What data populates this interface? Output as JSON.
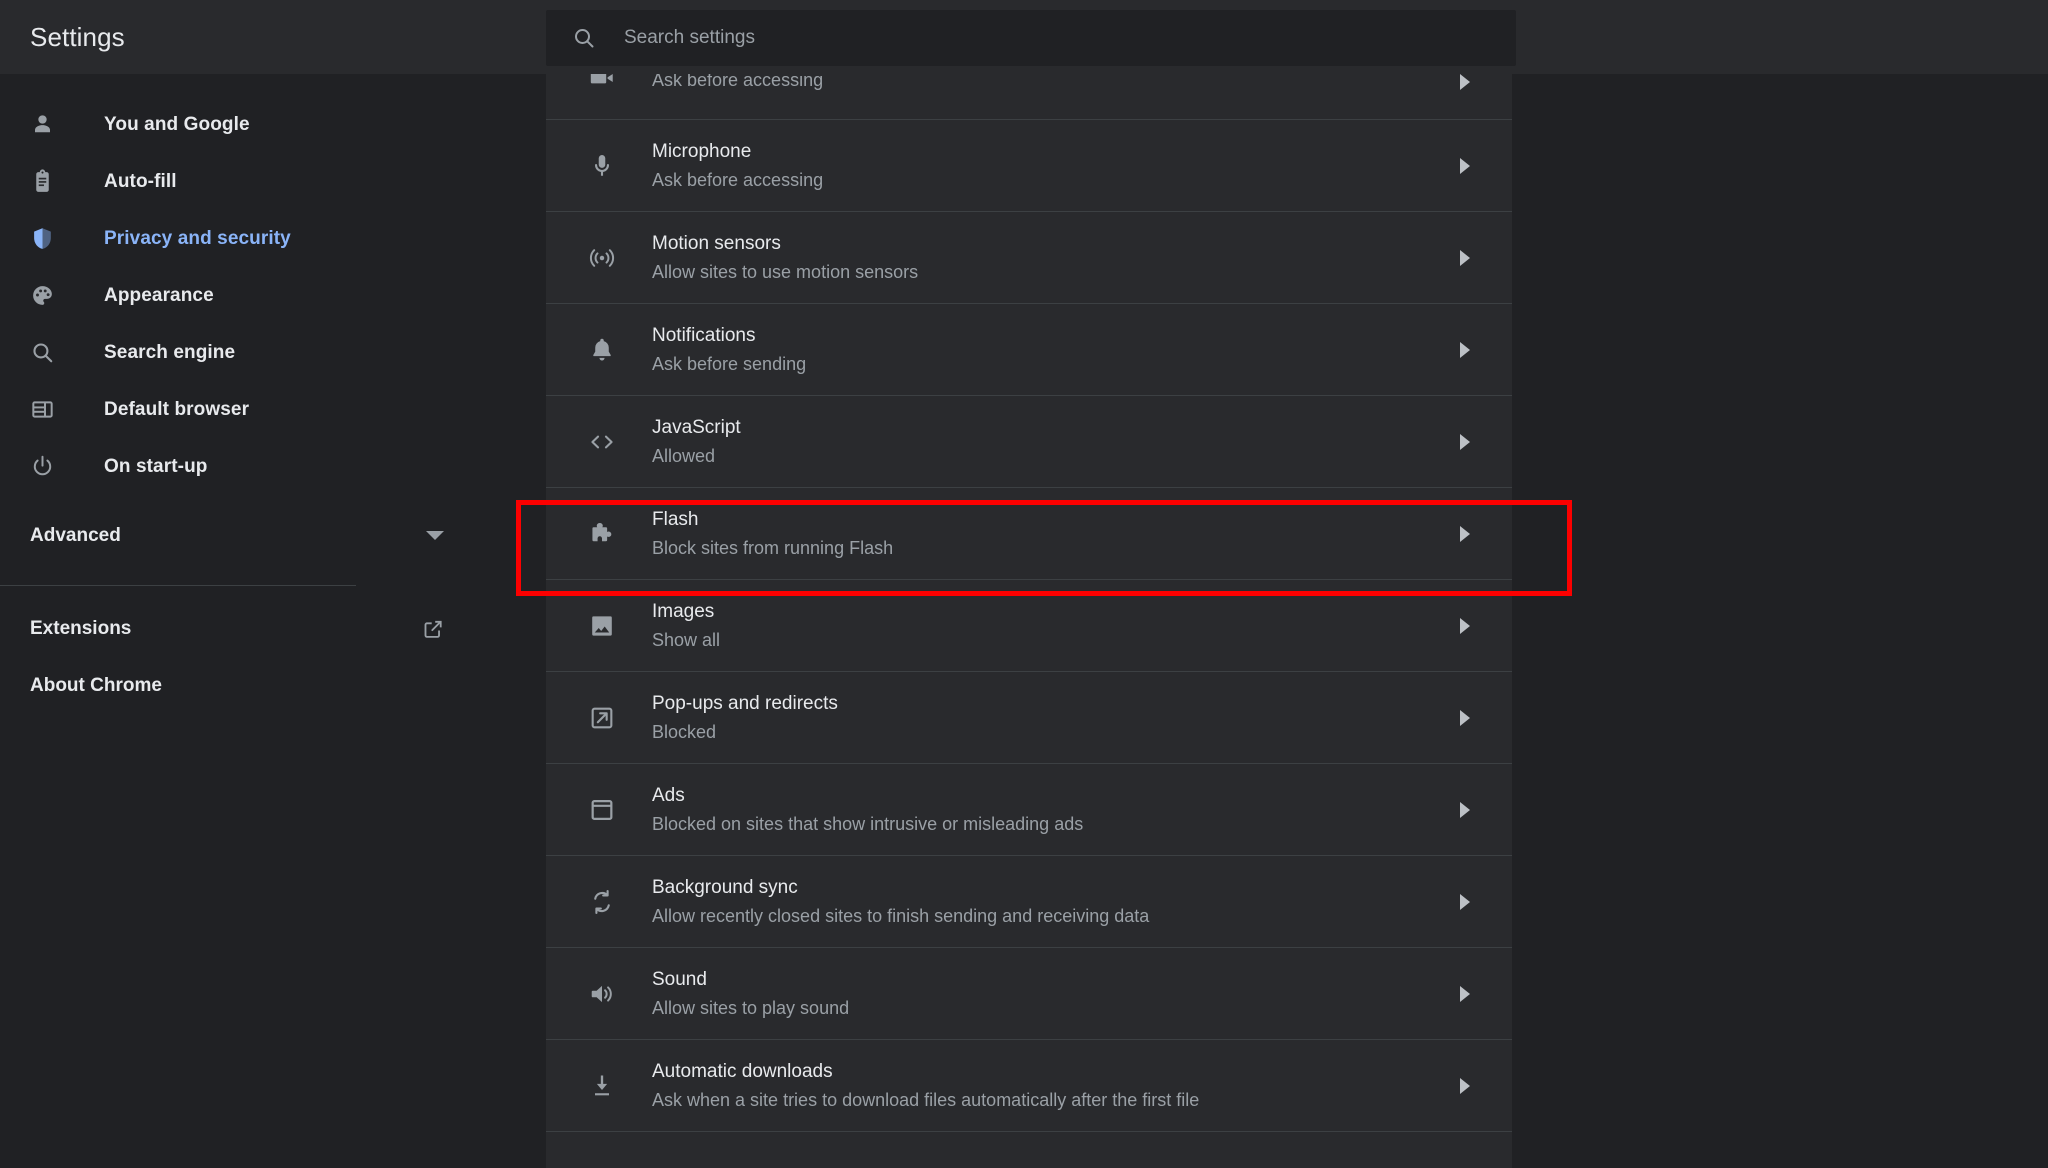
{
  "topbar": {
    "title": "Settings",
    "search": {
      "placeholder": "Search settings",
      "value": "",
      "icon": "search-icon"
    }
  },
  "sidebar": {
    "items": [
      {
        "label": "You and Google",
        "icon": "person-icon",
        "active": false
      },
      {
        "label": "Auto-fill",
        "icon": "clipboard-icon",
        "active": false
      },
      {
        "label": "Privacy and security",
        "icon": "shield-icon",
        "active": true
      },
      {
        "label": "Appearance",
        "icon": "palette-icon",
        "active": false
      },
      {
        "label": "Search engine",
        "icon": "magnifier-icon",
        "active": false
      },
      {
        "label": "Default browser",
        "icon": "browser-window-icon",
        "active": false
      },
      {
        "label": "On start-up",
        "icon": "power-icon",
        "active": false
      }
    ],
    "advanced": {
      "label": "Advanced",
      "icon": "chevron-down-icon"
    },
    "footer": [
      {
        "label": "Extensions",
        "icon": "external-link-icon"
      },
      {
        "label": "About Chrome",
        "icon": ""
      }
    ]
  },
  "content": {
    "rows": [
      {
        "title": "",
        "sub": "Ask before accessing",
        "icon": "camera-icon",
        "partial": true,
        "highlighted": false
      },
      {
        "title": "Microphone",
        "sub": "Ask before accessing",
        "icon": "microphone-icon",
        "partial": false,
        "highlighted": false
      },
      {
        "title": "Motion sensors",
        "sub": "Allow sites to use motion sensors",
        "icon": "motion-sensor-icon",
        "partial": false,
        "highlighted": false
      },
      {
        "title": "Notifications",
        "sub": "Ask before sending",
        "icon": "bell-icon",
        "partial": false,
        "highlighted": false
      },
      {
        "title": "JavaScript",
        "sub": "Allowed",
        "icon": "code-brackets-icon",
        "partial": false,
        "highlighted": false
      },
      {
        "title": "Flash",
        "sub": "Block sites from running Flash",
        "icon": "puzzle-piece-icon",
        "partial": false,
        "highlighted": true
      },
      {
        "title": "Images",
        "sub": "Show all",
        "icon": "image-icon",
        "partial": false,
        "highlighted": false
      },
      {
        "title": "Pop-ups and redirects",
        "sub": "Blocked",
        "icon": "external-link-icon",
        "partial": false,
        "highlighted": false
      },
      {
        "title": "Ads",
        "sub": "Blocked on sites that show intrusive or misleading ads",
        "icon": "window-icon",
        "partial": false,
        "highlighted": false
      },
      {
        "title": "Background sync",
        "sub": "Allow recently closed sites to finish sending and receiving data",
        "icon": "sync-icon",
        "partial": false,
        "highlighted": false
      },
      {
        "title": "Sound",
        "sub": "Allow sites to play sound",
        "icon": "speaker-icon",
        "partial": false,
        "highlighted": false
      },
      {
        "title": "Automatic downloads",
        "sub": "Ask when a site tries to download files automatically after the first file",
        "icon": "download-icon",
        "partial": false,
        "highlighted": false
      }
    ],
    "chevron_icon": "chevron-right-icon"
  },
  "colors": {
    "page_background": "#202124",
    "panel_background": "#292a2d",
    "divider": "#3c4043",
    "primary_text": "#e8eaed",
    "secondary_text": "#9aa0a6",
    "accent": "#8ab4f8",
    "highlight_border": "#fc0000"
  }
}
